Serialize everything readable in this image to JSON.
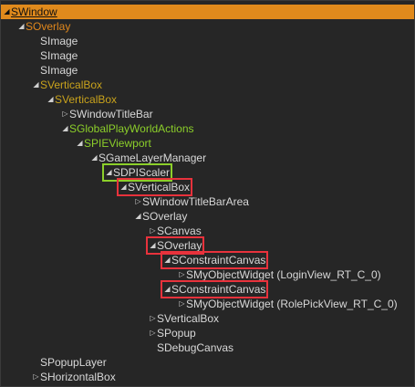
{
  "tree": {
    "nodes": [
      {
        "label": "SWindow",
        "color": "black",
        "arrow": "down",
        "selected": true
      },
      {
        "label": "SOverlay",
        "color": "orange",
        "arrow": "down"
      },
      {
        "label": "SImage",
        "color": "white",
        "arrow": "none"
      },
      {
        "label": "SImage",
        "color": "white",
        "arrow": "none"
      },
      {
        "label": "SImage",
        "color": "white",
        "arrow": "none"
      },
      {
        "label": "SVerticalBox",
        "color": "gold",
        "arrow": "down"
      },
      {
        "label": "SVerticalBox",
        "color": "gold",
        "arrow": "down"
      },
      {
        "label": "SWindowTitleBar",
        "color": "white",
        "arrow": "right"
      },
      {
        "label": "SGlobalPlayWorldActions",
        "color": "green",
        "arrow": "down"
      },
      {
        "label": "SPIEViewport",
        "color": "green",
        "arrow": "down"
      },
      {
        "label": "SGameLayerManager",
        "color": "white",
        "arrow": "down"
      },
      {
        "label": "SDPIScaler",
        "color": "white",
        "arrow": "down",
        "highlight": "green"
      },
      {
        "label": "SVerticalBox",
        "color": "white",
        "arrow": "down",
        "highlight": "red"
      },
      {
        "label": "SWindowTitleBarArea",
        "color": "white",
        "arrow": "right"
      },
      {
        "label": "SOverlay",
        "color": "white",
        "arrow": "down"
      },
      {
        "label": "SCanvas",
        "color": "white",
        "arrow": "right"
      },
      {
        "label": "SOverlay",
        "color": "white",
        "arrow": "down",
        "highlight": "red"
      },
      {
        "label": "SConstraintCanvas",
        "color": "white",
        "arrow": "down",
        "highlight": "red"
      },
      {
        "label": "SMyObjectWidget (LoginView_RT_C_0)",
        "color": "white",
        "arrow": "right"
      },
      {
        "label": "SConstraintCanvas",
        "color": "white",
        "arrow": "down",
        "highlight": "red"
      },
      {
        "label": "SMyObjectWidget (RolePickView_RT_C_0)",
        "color": "white",
        "arrow": "right"
      },
      {
        "label": "SVerticalBox",
        "color": "white",
        "arrow": "right"
      },
      {
        "label": "SPopup",
        "color": "white",
        "arrow": "right"
      },
      {
        "label": "SDebugCanvas",
        "color": "white",
        "arrow": "none"
      },
      {
        "label": "SPopupLayer",
        "color": "white",
        "arrow": "none"
      },
      {
        "label": "SHorizontalBox",
        "color": "white",
        "arrow": "right"
      }
    ]
  },
  "colors": {
    "background": "#262626",
    "selection": "#e08a1c",
    "orange": "#e0871c",
    "gold": "#c9a31c",
    "green": "#8ccf2a",
    "highlight_red": "#e8323c",
    "highlight_green": "#8ccf2a"
  }
}
